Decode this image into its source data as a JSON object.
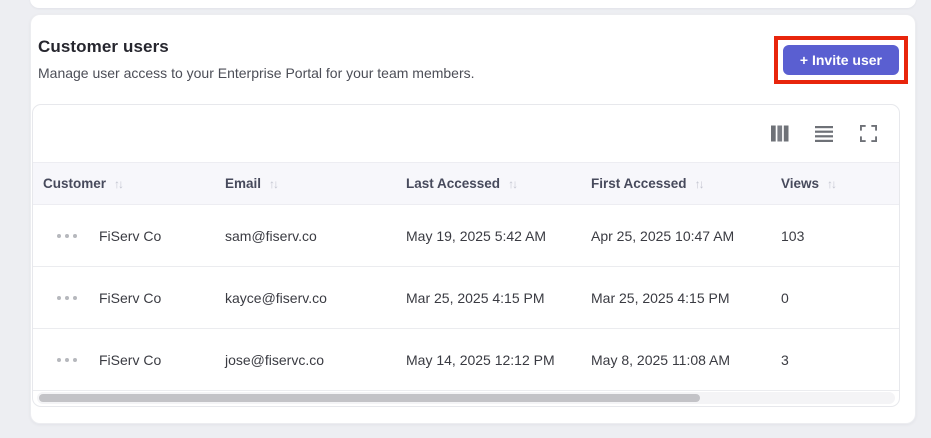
{
  "colors": {
    "page_bg": "#edeef2",
    "accent": "#5a5fd1",
    "highlight": "#e8250c",
    "header_bg": "#f7f7fb"
  },
  "panel": {
    "title": "Customer users",
    "subtitle": "Manage user access to your Enterprise Portal for your team members.",
    "invite_button_label": "+ Invite user"
  },
  "toolbar": {
    "icons": [
      "columns-icon",
      "density-icon",
      "fullscreen-icon"
    ]
  },
  "table": {
    "sort_glyph": "↑↓",
    "columns": [
      {
        "label": "Customer"
      },
      {
        "label": "Email"
      },
      {
        "label": "Last Accessed"
      },
      {
        "label": "First Accessed"
      },
      {
        "label": "Views"
      }
    ],
    "rows": [
      {
        "customer": "FiServ Co",
        "email": "sam@fiserv.co",
        "last_accessed": "May 19, 2025 5:42 AM",
        "first_accessed": "Apr 25, 2025 10:47 AM",
        "views": "103"
      },
      {
        "customer": "FiServ Co",
        "email": "kayce@fiserv.co",
        "last_accessed": "Mar 25, 2025 4:15 PM",
        "first_accessed": "Mar 25, 2025 4:15 PM",
        "views": "0"
      },
      {
        "customer": "FiServ Co",
        "email": "jose@fiservc.co",
        "last_accessed": "May 14, 2025 12:12 PM",
        "first_accessed": "May 8, 2025 11:08 AM",
        "views": "3"
      }
    ]
  },
  "scrollbar": {
    "orientation": "horizontal",
    "thumb_percent": 77
  }
}
